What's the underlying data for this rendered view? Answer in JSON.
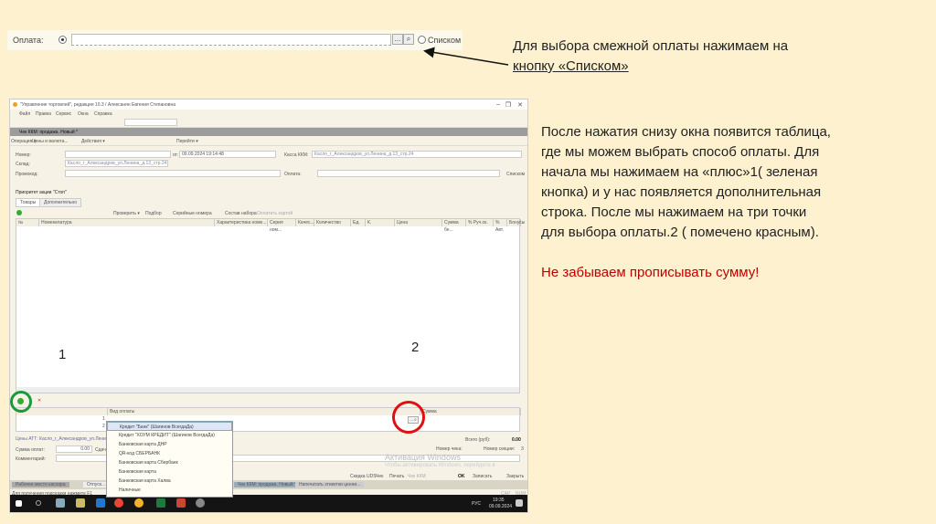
{
  "top_strip": {
    "label": "Оплата:",
    "button_dots": "...",
    "search_icon": "magnifier-icon",
    "radio_list_label": "Списком"
  },
  "notes": {
    "note1": "Для выбора смежной оплаты нажимаем на кнопку «Списком»",
    "note1_line1": "Для выбора смежной оплаты нажимаем на",
    "note1_line2": "кнопку «Списком»",
    "note2_lines": [
      "После нажатия снизу окна появится таблица,",
      "где мы можем выбрать способ оплаты. Для",
      "начала мы нажимаем на «плюс»1( зеленая",
      "кнопка) и у нас появляется дополнительная",
      "строка. После мы нажимаем на три точки",
      "для выбора оплаты.2 ( помечено красным)."
    ],
    "warning": "Не забываем прописывать сумму!",
    "warning_color": "#c00000"
  },
  "annotations": {
    "marker1": "1",
    "marker2": "2",
    "circle1_color": "#1a9a3a",
    "circle2_color": "#e01010"
  },
  "window": {
    "title": "\"Управление торговлей\", редакция 10.3 / Алексанян Евгения Степановна",
    "menu": [
      "Файл",
      "Правка",
      "Сервис",
      "Окна",
      "Справка"
    ],
    "doc_title": "Чек ККМ: продажа. Новый *",
    "doc_toolbar": [
      "Операция ▾",
      "Цены и валюта...",
      "Действия ▾",
      "Перейти ▾"
    ],
    "form": {
      "number_label": "Номер:",
      "date_label": "от:",
      "date_value": "09.09.2024 19:14:48",
      "kassa_label": "Касса ККМ:",
      "kassa_value": "Касло_г_Александров_ул.Ленина_д.13_стр.24",
      "sklad_label": "Склад:",
      "sklad_value": "Касло_г_Александров_ул.Ленина_д.13_стр.24",
      "promo_label": "Промокод:",
      "payment_label": "Оплата:",
      "list_label": "Списком",
      "priority_label": "Приоритет акции \"Стоп\""
    },
    "tabs": [
      "Товары",
      "Дополнительно"
    ],
    "goods_toolbar": [
      "Проверить ▾",
      "Подбор",
      "Серийные номера",
      "Состав набора",
      "Оплатить картой"
    ],
    "goods_columns": [
      "№",
      "Номенклатура",
      "Характеристика номе...",
      "Серия ном...",
      "Качес...",
      "Количество",
      "Ед.",
      "К.",
      "Цена",
      "Сумма бе...",
      "% Руч.ск.",
      "% Авт.",
      "Бонусы"
    ],
    "payment_columns": [
      "№",
      "Вид оплаты",
      "Сумма"
    ],
    "payment_rows": [
      "1",
      "2"
    ],
    "prices_label": "Цены АТТ: Касло_г_Александров_ул.Ленина...",
    "sum_label": "Сумма оплат:",
    "sum_value": "0.00",
    "change_label": "Сдача",
    "comment_label": "Комментарий:",
    "total_label": "Всего (руб):",
    "total_value": "0.00",
    "check_no_label": "Номер чека:",
    "section_label": "Номер секции:",
    "section_value": "3",
    "watermark1": "Активация Windows",
    "watermark2": "Чтобы активировать Windows, перейдите в",
    "bottom_buttons": [
      "Скидка UDS",
      "Чек",
      "Печать",
      "Чек ККМ",
      "OK",
      "Записать",
      "Закрыть"
    ],
    "open_tabs": [
      "Рабочее место кассира",
      "Отпуск...",
      "Чек ККМ: продажа. Новый *",
      "Напечатать этикетки ценни..."
    ],
    "status_hint": "Для получения подсказки нажмите F1",
    "status_right": [
      "CAP",
      "NUM"
    ],
    "dropdown": [
      "Кредит \"Банк\" (Шагинов ВсегдаДа)",
      "Кредит \"ХОУМ КРЕДИТ\" (Шагинов ВсегдаДа)",
      "Банковская карта ДНР",
      "QR-код СБЕРБАНК",
      "Банковская карта Сбербанк",
      "Банковская карта",
      "Банковская карта Халва",
      "Наличные"
    ],
    "taskbar": {
      "lang": "РУС",
      "time": "19:35",
      "date": "09.09.2024"
    }
  }
}
